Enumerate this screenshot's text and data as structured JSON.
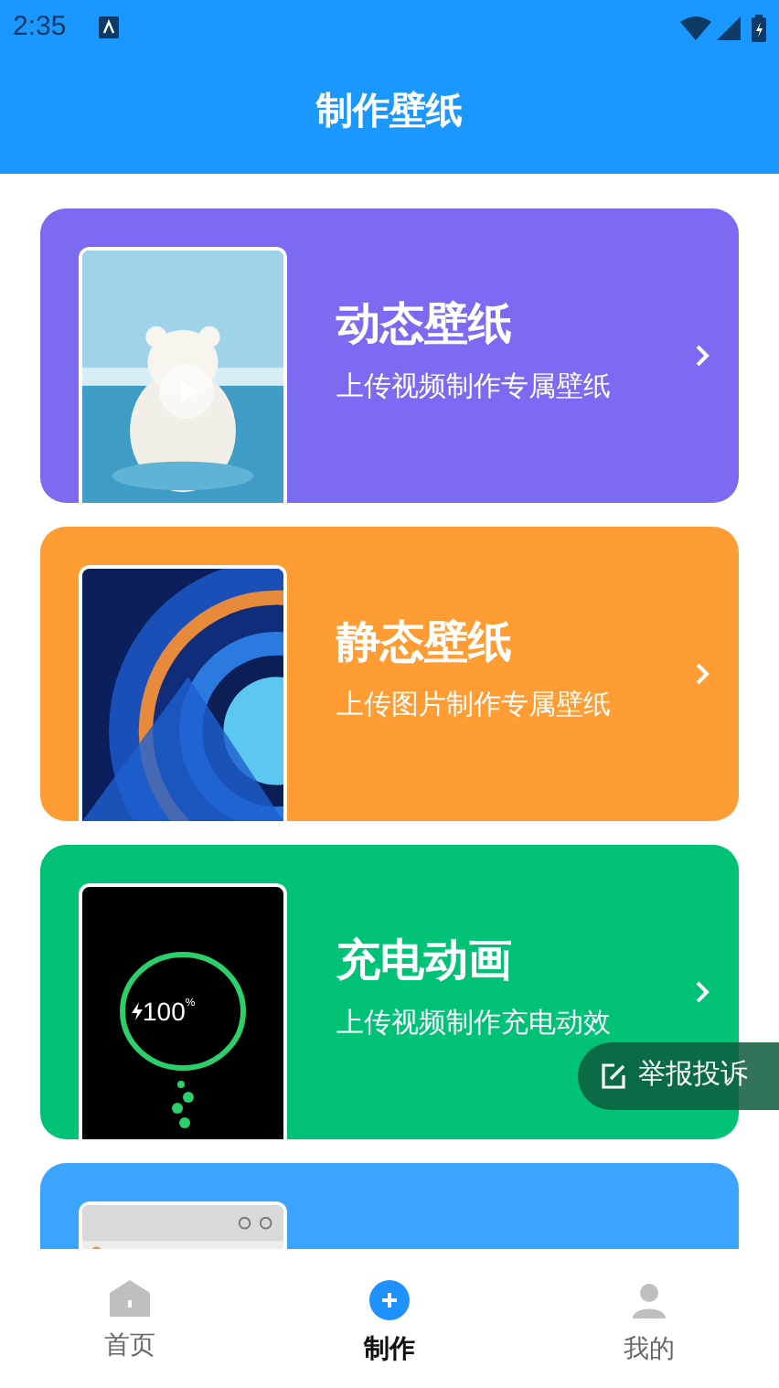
{
  "status_bar": {
    "time": "2:35"
  },
  "header": {
    "title": "制作壁纸"
  },
  "cards": [
    {
      "kind": "video",
      "color": "#7d6af2",
      "title": "动态壁纸",
      "subtitle": "上传视频制作专属壁纸"
    },
    {
      "color": "#ff9c33",
      "title": "静态壁纸",
      "subtitle": "上传图片制作专属壁纸"
    },
    {
      "kind": "charging",
      "color": "#00c277",
      "title": "充电动画",
      "subtitle": "上传视频制作充电动效",
      "preview_text": "100",
      "preview_unit": "%"
    },
    {
      "kind": "app",
      "color": "#3aa4ff"
    }
  ],
  "report_button": {
    "label": "举报投诉"
  },
  "nav": [
    {
      "kind": "home",
      "label": "首页",
      "selected": false
    },
    {
      "kind": "create",
      "label": "制作",
      "selected": true
    },
    {
      "kind": "profile",
      "label": "我的",
      "selected": false
    }
  ]
}
